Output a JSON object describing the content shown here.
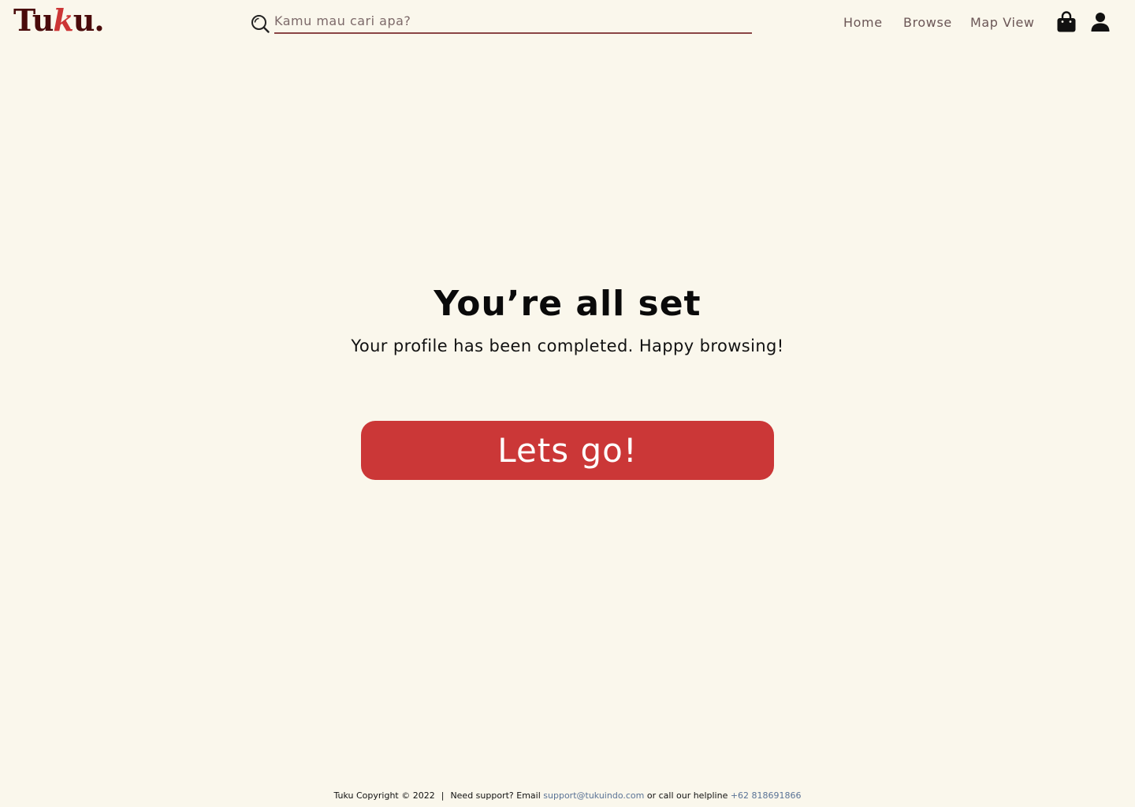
{
  "header": {
    "logo": {
      "part1": "Tu",
      "part2": "k",
      "part3": "u."
    },
    "search": {
      "placeholder": "Kamu mau cari apa?",
      "value": "",
      "icon": "search-icon"
    },
    "nav": [
      {
        "label": "Home"
      },
      {
        "label": "Browse"
      },
      {
        "label": "Map View"
      }
    ],
    "icons": {
      "cart": "shopping-bag-icon",
      "profile": "user-icon"
    }
  },
  "main": {
    "title": "You’re all set",
    "subtitle": "Your profile has been completed. Happy browsing!",
    "cta_label": "Lets go!"
  },
  "footer": {
    "copyright": "Tuku Copyright © 2022",
    "separator": "|",
    "support_text": "Need support? Email",
    "email": "support@tukuindo.com",
    "helpline_text": "or call our helpline",
    "phone": "+62 818691866"
  },
  "colors": {
    "background": "#faf7ec",
    "brand_dark": "#4a0b0b",
    "accent_red": "#cb3737",
    "nav_text": "#6b5656",
    "link": "#5a7396"
  }
}
